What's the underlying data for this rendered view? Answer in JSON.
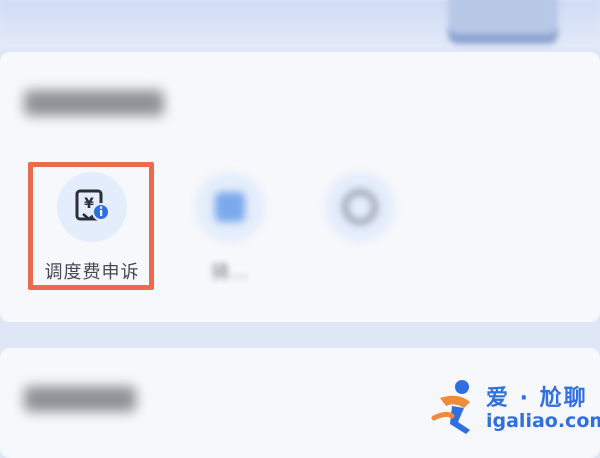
{
  "section_1": {
    "tiles": [
      {
        "label": "调度费申诉",
        "icon": "receipt-yen-info-icon",
        "highlighted": true
      },
      {
        "label": "骑…",
        "icon": "blurred-icon",
        "highlighted": false
      },
      {
        "label": "",
        "icon": "blurred-icon",
        "highlighted": false
      }
    ]
  },
  "colors": {
    "highlight": "#ec6b4c",
    "icon_bg": "#e4edfb",
    "icon_dark": "#2b2f36",
    "badge": "#2f6fe0"
  },
  "watermark": {
    "title": "爱 · 尬聊",
    "url": "igaliao.com"
  }
}
